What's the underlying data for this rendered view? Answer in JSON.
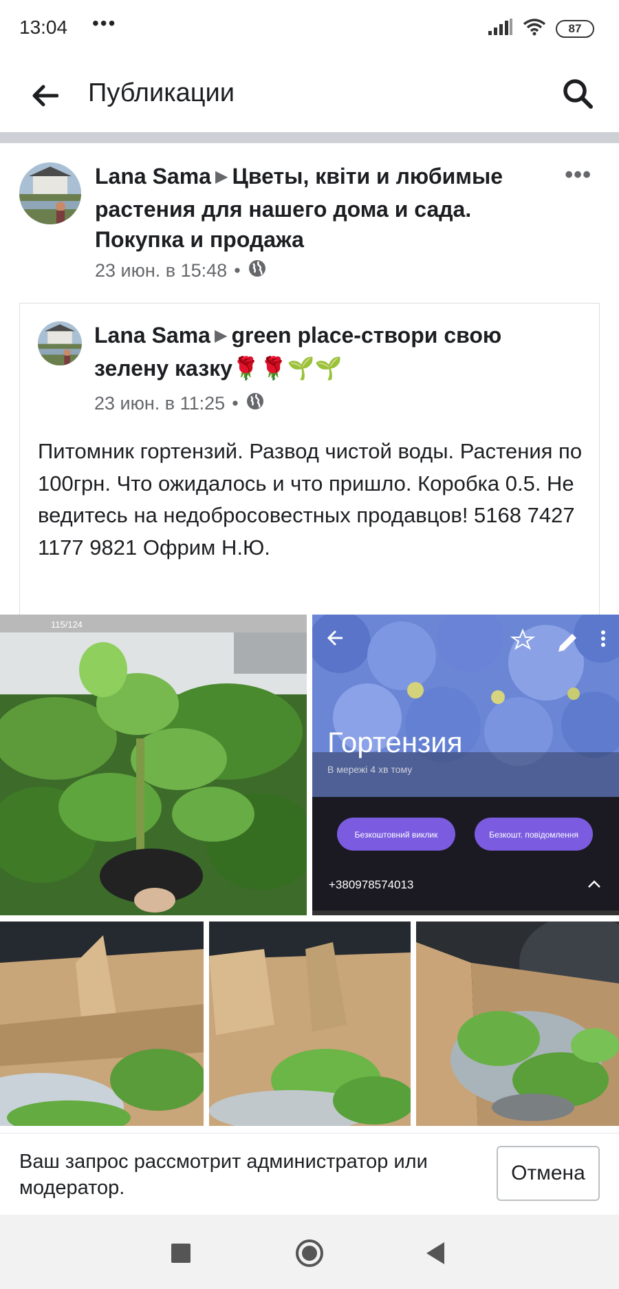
{
  "status_bar": {
    "time": "13:04",
    "dots": "•••",
    "battery": "87"
  },
  "header": {
    "title": "Публикации"
  },
  "post": {
    "author": "Lana Sama",
    "group": "Цветы, квіти и любимые растения  для нашего дома  и сада. Покупка и продажа",
    "time": "23 июн. в 15:48",
    "separator": "•",
    "more": "•••",
    "shared": {
      "author": "Lana Sama",
      "group": "green place-створи свою зелену казку🌹🌹🌱🌱",
      "time": "23 июн. в 11:25",
      "text": "Питомник гортензий. Развод чистой воды. Растения по 100грн. Что ожидалось и что пришло. Коробка 0.5. Не ведитесь на недобросовестных продавцов! 5168 7427 1177 9821 Офрим Н.Ю."
    },
    "photos": {
      "counter": "115/124",
      "contact_name": "Гортензия",
      "contact_status": "В мережі 4 хв тому",
      "call_button": "Безкоштовний виклик",
      "message_button": "Безкошт. повідомлення",
      "phone": "+380978574013"
    }
  },
  "pending": {
    "text": "Ваш запрос рассмотрит администратор или модератор.",
    "cancel_label": "Отмена"
  },
  "colors": {
    "accent": "#7b5ce0",
    "secondary_text": "#65676b",
    "divider": "#cdd0d4"
  }
}
